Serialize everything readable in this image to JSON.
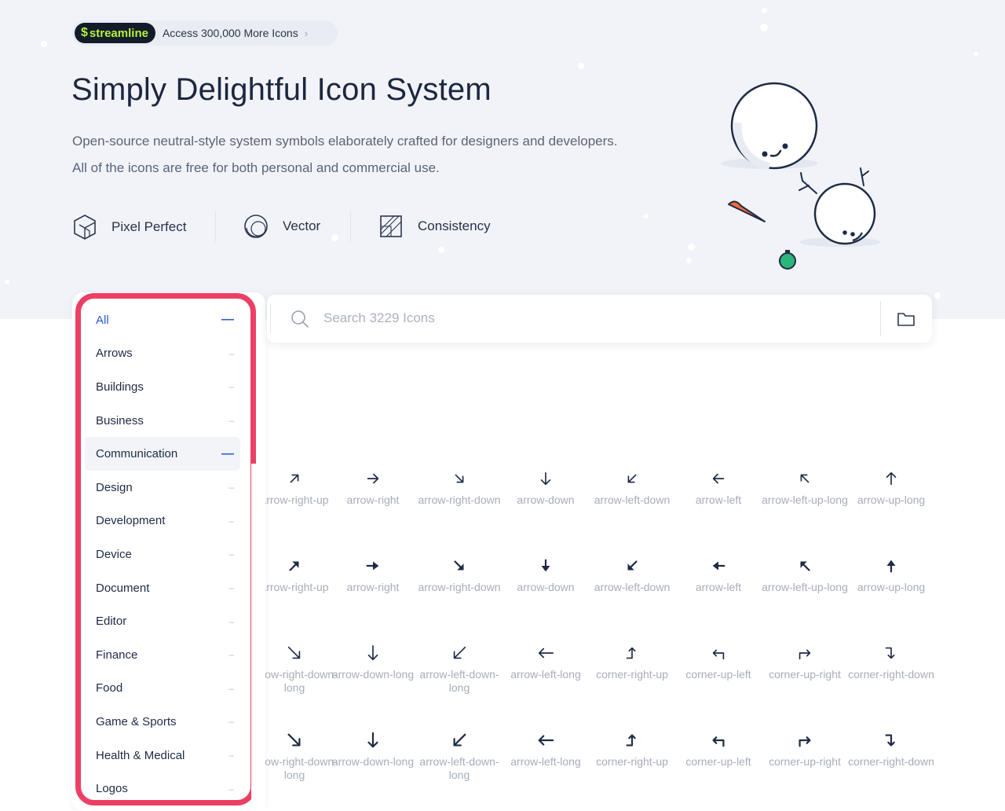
{
  "promo": {
    "brand": "streamline",
    "text": "Access 300,000 More Icons"
  },
  "hero": {
    "title": "Simply Delightful Icon System",
    "desc_line1": "Open-source neutral-style system symbols elaborately crafted for designers and developers.",
    "desc_line2": "All of the icons are free for both personal and commercial use."
  },
  "features": [
    {
      "label": "Pixel Perfect",
      "icon": "cube-icon"
    },
    {
      "label": "Vector",
      "icon": "circle-vector-icon"
    },
    {
      "label": "Consistency",
      "icon": "grid-frame-icon"
    }
  ],
  "sidebar": {
    "items": [
      {
        "label": "All",
        "state": "active"
      },
      {
        "label": "Arrows"
      },
      {
        "label": "Buildings"
      },
      {
        "label": "Business"
      },
      {
        "label": "Communication",
        "state": "hover"
      },
      {
        "label": "Design"
      },
      {
        "label": "Development"
      },
      {
        "label": "Device"
      },
      {
        "label": "Document"
      },
      {
        "label": "Editor"
      },
      {
        "label": "Finance"
      },
      {
        "label": "Food"
      },
      {
        "label": "Game & Sports"
      },
      {
        "label": "Health & Medical"
      },
      {
        "label": "Logos"
      }
    ]
  },
  "search": {
    "placeholder": "Search 3229 Icons"
  },
  "icons": {
    "rows": [
      [
        {
          "name": "arrow-right-up",
          "label": "arrow-right-up",
          "glyph": "up-right"
        },
        {
          "name": "arrow-right",
          "label": "arrow-right",
          "glyph": "right"
        },
        {
          "name": "arrow-right-down",
          "label": "arrow-right-down",
          "glyph": "down-right"
        },
        {
          "name": "arrow-down",
          "label": "arrow-down",
          "glyph": "down"
        },
        {
          "name": "arrow-left-down",
          "label": "arrow-left-down",
          "glyph": "down-left"
        },
        {
          "name": "arrow-left",
          "label": "arrow-left",
          "glyph": "left"
        },
        {
          "name": "arrow-left-up-long",
          "label": "arrow-left-up-long",
          "glyph": "up-left"
        },
        {
          "name": "arrow-up-long",
          "label": "arrow-up-long",
          "glyph": "up"
        }
      ],
      [
        {
          "name": "arrow-right-up",
          "label": "arrow-right-up",
          "glyph": "up-right"
        },
        {
          "name": "arrow-right",
          "label": "arrow-right",
          "glyph": "right"
        },
        {
          "name": "arrow-right-down",
          "label": "arrow-right-down",
          "glyph": "down-right"
        },
        {
          "name": "arrow-down",
          "label": "arrow-down",
          "glyph": "down"
        },
        {
          "name": "arrow-left-down",
          "label": "arrow-left-down",
          "glyph": "down-left"
        },
        {
          "name": "arrow-left",
          "label": "arrow-left",
          "glyph": "left"
        },
        {
          "name": "arrow-left-up-long",
          "label": "arrow-left-up-long",
          "glyph": "up-left"
        },
        {
          "name": "arrow-up-long",
          "label": "arrow-up-long",
          "glyph": "up"
        }
      ],
      [
        {
          "name": "arrow-right-down-long",
          "label": "arrow-right-down-long",
          "glyph": "down-right"
        },
        {
          "name": "arrow-down-long",
          "label": "arrow-down-long",
          "glyph": "down"
        },
        {
          "name": "arrow-left-down-long",
          "label": "arrow-left-down-long",
          "glyph": "down-left"
        },
        {
          "name": "arrow-left-long",
          "label": "arrow-left-long",
          "glyph": "left"
        },
        {
          "name": "corner-right-up",
          "label": "corner-right-up",
          "glyph": "corner-right-up"
        },
        {
          "name": "corner-up-left",
          "label": "corner-up-left",
          "glyph": "corner-up-left"
        },
        {
          "name": "corner-up-right",
          "label": "corner-up-right",
          "glyph": "corner-up-right"
        },
        {
          "name": "corner-right-down",
          "label": "corner-right-down",
          "glyph": "corner-right-down"
        }
      ],
      [
        {
          "name": "arrow-right-down-long",
          "label": "arrow-right-down-long",
          "glyph": "down-right"
        },
        {
          "name": "arrow-down-long",
          "label": "arrow-down-long",
          "glyph": "down"
        },
        {
          "name": "arrow-left-down-long",
          "label": "arrow-left-down-long",
          "glyph": "down-left"
        },
        {
          "name": "arrow-left-long",
          "label": "arrow-left-long",
          "glyph": "left"
        },
        {
          "name": "corner-right-up",
          "label": "corner-right-up",
          "glyph": "corner-right-up"
        },
        {
          "name": "corner-up-left",
          "label": "corner-up-left",
          "glyph": "corner-up-left"
        },
        {
          "name": "corner-up-right",
          "label": "corner-up-right",
          "glyph": "corner-up-right"
        },
        {
          "name": "corner-right-down",
          "label": "corner-right-down",
          "glyph": "corner-right-down"
        }
      ]
    ]
  },
  "colors": {
    "accent": "#2b5bd7",
    "highlight": "#ec3f64",
    "brand_green": "#b6f23a",
    "text": "#1e2b45",
    "muted": "#a6adba"
  }
}
